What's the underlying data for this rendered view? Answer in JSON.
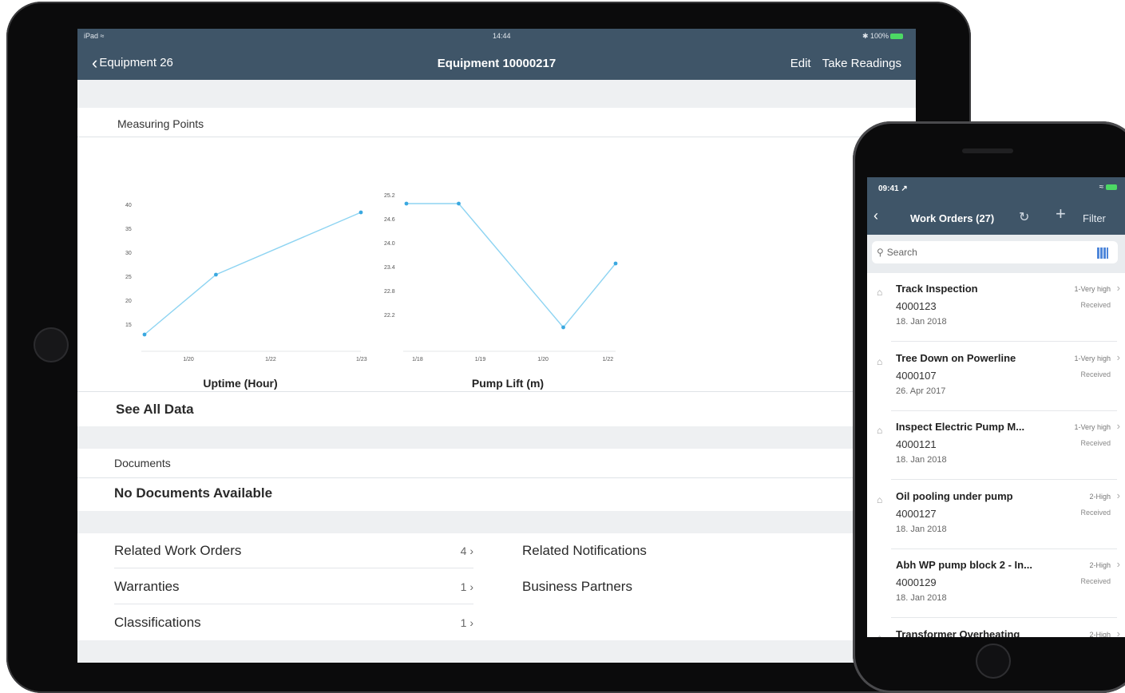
{
  "ipad": {
    "status": {
      "left": "iPad ≈",
      "time": "14:44",
      "right": "✱ 100%"
    },
    "nav": {
      "back_label": "Equipment 26",
      "title": "Equipment 10000217",
      "edit_label": "Edit",
      "take_readings_label": "Take Readings"
    },
    "measuring_points_header": "Measuring Points",
    "see_all_data": "See All Data",
    "documents_header": "Documents",
    "no_documents": "No Documents Available",
    "related": {
      "work_orders": {
        "label": "Related Work Orders",
        "count": "4"
      },
      "warranties": {
        "label": "Warranties",
        "count": "1"
      },
      "classifications": {
        "label": "Classifications",
        "count": "1"
      },
      "notifications": {
        "label": "Related Notifications"
      },
      "business_partners": {
        "label": "Business Partners"
      }
    }
  },
  "chart_data": [
    {
      "type": "line",
      "xlabel": "Uptime (Hour)",
      "x": [
        "1/19",
        "1/21",
        "1/23"
      ],
      "x_ticks": [
        "1/20",
        "1/22",
        "1/23"
      ],
      "y_ticks": [
        "40",
        "35",
        "30",
        "25",
        "20",
        "15"
      ],
      "values": [
        13,
        25.5,
        38.5
      ],
      "color": "#8ed4f2"
    },
    {
      "type": "line",
      "xlabel": "Pump Lift (m)",
      "x": [
        "1/17",
        "1/18",
        "1/20",
        "1/22"
      ],
      "x_ticks": [
        "1/18",
        "1/19",
        "1/20",
        "1/22"
      ],
      "y_ticks": [
        "25.2",
        "24.6",
        "24.0",
        "23.4",
        "22.8",
        "22.2"
      ],
      "values": [
        25.0,
        25.0,
        21.9,
        23.5
      ],
      "color": "#8ed4f2"
    }
  ],
  "iphone": {
    "time": "09:41 ↗",
    "status_right": "≈",
    "back": "‹",
    "title": "Work Orders (27)",
    "refresh": "↻",
    "add": "+",
    "filter": "Filter",
    "search_placeholder": "Search",
    "work_orders": [
      {
        "title": "Track Inspection",
        "number": "4000123",
        "date": "18. Jan 2018",
        "priority": "1-Very high",
        "status": "Received",
        "clip": "⌂"
      },
      {
        "title": "Tree Down on Powerline",
        "number": "4000107",
        "date": "26. Apr 2017",
        "priority": "1-Very high",
        "status": "Received",
        "clip": "⌂"
      },
      {
        "title": "Inspect Electric Pump M...",
        "number": "4000121",
        "date": "18. Jan 2018",
        "priority": "1-Very high",
        "status": "Received",
        "clip": "⌂"
      },
      {
        "title": "Oil pooling under pump",
        "number": "4000127",
        "date": "18. Jan 2018",
        "priority": "2-High",
        "status": "Received",
        "clip": "⌂"
      },
      {
        "title": "Abh WP pump block 2 - In...",
        "number": "4000129",
        "date": "18. Jan 2018",
        "priority": "2-High",
        "status": "Received",
        "clip": ""
      },
      {
        "title": "Transformer Overheating",
        "number": "",
        "date": "",
        "priority": "2-High",
        "status": "",
        "clip": "⌂"
      }
    ]
  }
}
